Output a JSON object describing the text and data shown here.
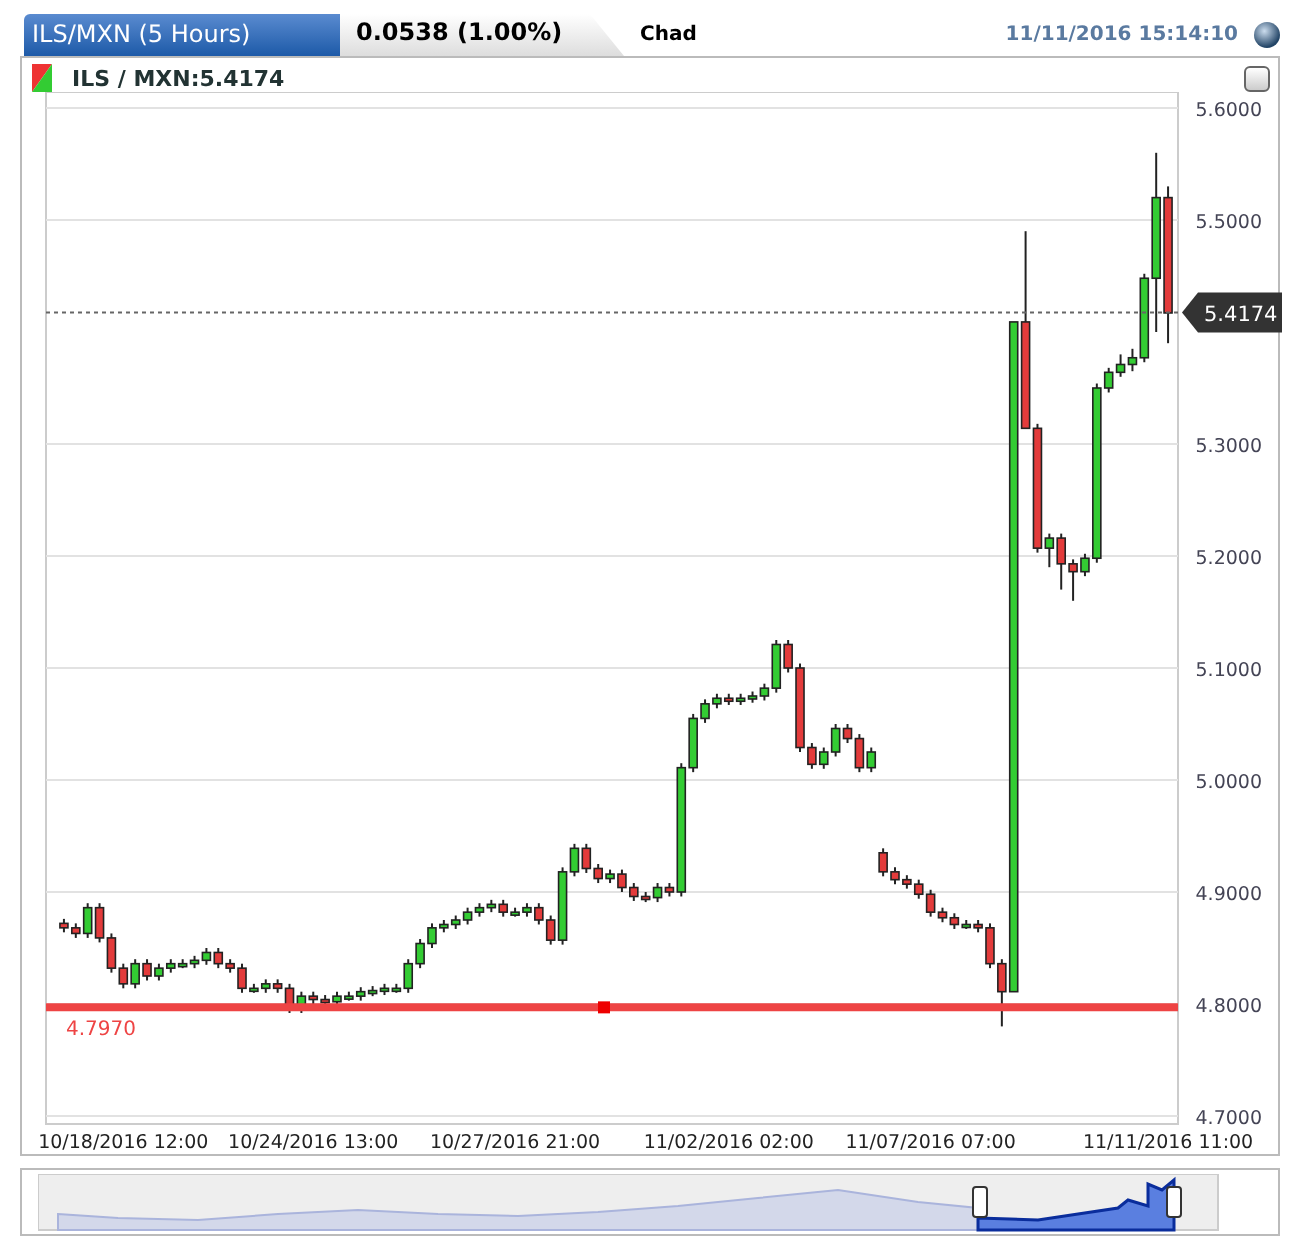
{
  "header": {
    "title": "ILS/MXN (5 Hours)",
    "change": "0.0538 (1.00%)",
    "location": "Chad",
    "timestamp": "11/11/2016 15:14:10"
  },
  "chart_panel": {
    "legend": "ILS / MXN:5.4174",
    "chart_data": {
      "type": "candlestick",
      "grid": true,
      "ylim": [
        4.7,
        5.6
      ],
      "categories": [
        null,
        null,
        null,
        null,
        null,
        "10/18/2016 12:00",
        null,
        null,
        null,
        null,
        null,
        null,
        null,
        null,
        null,
        null,
        null,
        null,
        null,
        null,
        null,
        "10/24/2016 13:00",
        null,
        null,
        null,
        null,
        null,
        null,
        null,
        null,
        null,
        null,
        null,
        null,
        null,
        null,
        null,
        null,
        "10/27/2016 21:00",
        null,
        null,
        null,
        null,
        null,
        null,
        null,
        null,
        null,
        null,
        null,
        null,
        null,
        null,
        null,
        null,
        null,
        "11/02/2016 02:00",
        null,
        null,
        null,
        null,
        null,
        null,
        null,
        null,
        null,
        null,
        null,
        null,
        null,
        null,
        null,
        null,
        "11/07/2016 07:00",
        null,
        null,
        null,
        null,
        null,
        null,
        null,
        null,
        null,
        null,
        null,
        null,
        null,
        null,
        null,
        null,
        null,
        null,
        null,
        "11/11/2016 11:00"
      ],
      "ohlc": [
        [
          4.872,
          4.876,
          4.864,
          4.868
        ],
        [
          4.868,
          4.872,
          4.859,
          4.863
        ],
        [
          4.863,
          4.89,
          4.859,
          4.886
        ],
        [
          4.886,
          4.89,
          4.855,
          4.859
        ],
        [
          4.859,
          4.863,
          4.828,
          4.832
        ],
        [
          4.832,
          4.836,
          4.814,
          4.818
        ],
        [
          4.818,
          4.84,
          4.814,
          4.836
        ],
        [
          4.836,
          4.84,
          4.821,
          4.825
        ],
        [
          4.825,
          4.836,
          4.821,
          4.832
        ],
        [
          4.832,
          4.84,
          4.828,
          4.836
        ],
        [
          4.836,
          4.84,
          4.832,
          4.836
        ],
        [
          4.836,
          4.843,
          4.832,
          4.839
        ],
        [
          4.839,
          4.85,
          4.835,
          4.846
        ],
        [
          4.846,
          4.85,
          4.832,
          4.836
        ],
        [
          4.836,
          4.84,
          4.828,
          4.832
        ],
        [
          4.832,
          4.836,
          4.81,
          4.814
        ],
        [
          4.814,
          4.818,
          4.81,
          4.814
        ],
        [
          4.814,
          4.822,
          4.81,
          4.818
        ],
        [
          4.818,
          4.822,
          4.81,
          4.814
        ],
        [
          4.814,
          4.818,
          4.792,
          4.796
        ],
        [
          4.796,
          4.811,
          4.792,
          4.807
        ],
        [
          4.807,
          4.811,
          4.8,
          4.804
        ],
        [
          4.804,
          4.808,
          4.798,
          4.802
        ],
        [
          4.802,
          4.811,
          4.798,
          4.807
        ],
        [
          4.807,
          4.811,
          4.803,
          4.807
        ],
        [
          4.807,
          4.815,
          4.803,
          4.811
        ],
        [
          4.811,
          4.816,
          4.807,
          4.812
        ],
        [
          4.812,
          4.818,
          4.808,
          4.814
        ],
        [
          4.814,
          4.818,
          4.81,
          4.814
        ],
        [
          4.814,
          4.84,
          4.81,
          4.836
        ],
        [
          4.836,
          4.858,
          4.832,
          4.854
        ],
        [
          4.854,
          4.872,
          4.85,
          4.868
        ],
        [
          4.868,
          4.875,
          4.864,
          4.871
        ],
        [
          4.871,
          4.879,
          4.867,
          4.875
        ],
        [
          4.875,
          4.886,
          4.871,
          4.882
        ],
        [
          4.882,
          4.89,
          4.878,
          4.886
        ],
        [
          4.886,
          4.893,
          4.882,
          4.889
        ],
        [
          4.889,
          4.893,
          4.878,
          4.882
        ],
        [
          4.882,
          4.886,
          4.878,
          4.882
        ],
        [
          4.882,
          4.89,
          4.878,
          4.886
        ],
        [
          4.886,
          4.89,
          4.871,
          4.875
        ],
        [
          4.875,
          4.879,
          4.853,
          4.857
        ],
        [
          4.857,
          4.922,
          4.853,
          4.918
        ],
        [
          4.918,
          4.943,
          4.914,
          4.939
        ],
        [
          4.939,
          4.943,
          4.917,
          4.921
        ],
        [
          4.921,
          4.925,
          4.908,
          4.912
        ],
        [
          4.912,
          4.92,
          4.908,
          4.916
        ],
        [
          4.916,
          4.92,
          4.9,
          4.904
        ],
        [
          4.904,
          4.908,
          4.892,
          4.896
        ],
        [
          4.896,
          4.9,
          4.891,
          4.895
        ],
        [
          4.895,
          4.908,
          4.891,
          4.904
        ],
        [
          4.904,
          4.908,
          4.896,
          4.9
        ],
        [
          4.9,
          5.015,
          4.896,
          5.011
        ],
        [
          5.011,
          5.059,
          5.007,
          5.055
        ],
        [
          5.055,
          5.072,
          5.051,
          5.068
        ],
        [
          5.068,
          5.077,
          5.064,
          5.073
        ],
        [
          5.073,
          5.077,
          5.067,
          5.071
        ],
        [
          5.071,
          5.077,
          5.067,
          5.073
        ],
        [
          5.073,
          5.079,
          5.069,
          5.075
        ],
        [
          5.075,
          5.086,
          5.071,
          5.082
        ],
        [
          5.082,
          5.125,
          5.078,
          5.121
        ],
        [
          5.121,
          5.125,
          5.096,
          5.1
        ],
        [
          5.1,
          5.104,
          5.025,
          5.029
        ],
        [
          5.029,
          5.033,
          5.01,
          5.014
        ],
        [
          5.014,
          5.029,
          5.01,
          5.025
        ],
        [
          5.025,
          5.05,
          5.021,
          5.046
        ],
        [
          5.046,
          5.05,
          5.033,
          5.037
        ],
        [
          5.037,
          5.041,
          5.007,
          5.011
        ],
        [
          5.011,
          5.029,
          5.007,
          5.025
        ],
        [
          4.935,
          4.939,
          4.914,
          4.918
        ],
        [
          4.918,
          4.922,
          4.907,
          4.911
        ],
        [
          4.911,
          4.915,
          4.903,
          4.907
        ],
        [
          4.907,
          4.911,
          4.894,
          4.898
        ],
        [
          4.898,
          4.902,
          4.878,
          4.882
        ],
        [
          4.882,
          4.886,
          4.873,
          4.877
        ],
        [
          4.877,
          4.881,
          4.867,
          4.871
        ],
        [
          4.871,
          4.875,
          4.867,
          4.871
        ],
        [
          4.871,
          4.875,
          4.864,
          4.868
        ],
        [
          4.868,
          4.872,
          4.832,
          4.836
        ],
        [
          4.836,
          4.84,
          4.78,
          4.811
        ],
        [
          4.811,
          5.409,
          4.811,
          5.409
        ],
        [
          5.409,
          5.49,
          5.314,
          5.314
        ],
        [
          5.314,
          5.318,
          5.203,
          5.207
        ],
        [
          5.207,
          5.22,
          5.19,
          5.216
        ],
        [
          5.216,
          5.22,
          5.17,
          5.193
        ],
        [
          5.193,
          5.197,
          5.16,
          5.186
        ],
        [
          5.186,
          5.202,
          5.182,
          5.198
        ],
        [
          5.198,
          5.354,
          5.194,
          5.35
        ],
        [
          5.35,
          5.368,
          5.346,
          5.364
        ],
        [
          5.364,
          5.38,
          5.36,
          5.371
        ],
        [
          5.371,
          5.385,
          5.365,
          5.377
        ],
        [
          5.377,
          5.452,
          5.373,
          5.448
        ],
        [
          5.448,
          5.56,
          5.4,
          5.52
        ],
        [
          5.52,
          5.53,
          5.39,
          5.417
        ]
      ],
      "yticks": [
        {
          "value": 4.7,
          "label": "4.7000"
        },
        {
          "value": 4.8,
          "label": "4.8000"
        },
        {
          "value": 4.9,
          "label": "4.9000"
        },
        {
          "value": 5.0,
          "label": "5.0000"
        },
        {
          "value": 5.1,
          "label": "5.1000"
        },
        {
          "value": 5.2,
          "label": "5.2000"
        },
        {
          "value": 5.3,
          "label": "5.3000"
        },
        {
          "value": 5.5,
          "label": "5.5000"
        },
        {
          "value": 5.6,
          "label": "5.6000"
        }
      ],
      "ref_lines": [
        {
          "axis": "y",
          "value": 4.797,
          "label": "4.7970",
          "color": "#ee4444"
        },
        {
          "axis": "y",
          "value": 5.4174,
          "label": "5.4174",
          "color": "#666666"
        }
      ]
    }
  }
}
